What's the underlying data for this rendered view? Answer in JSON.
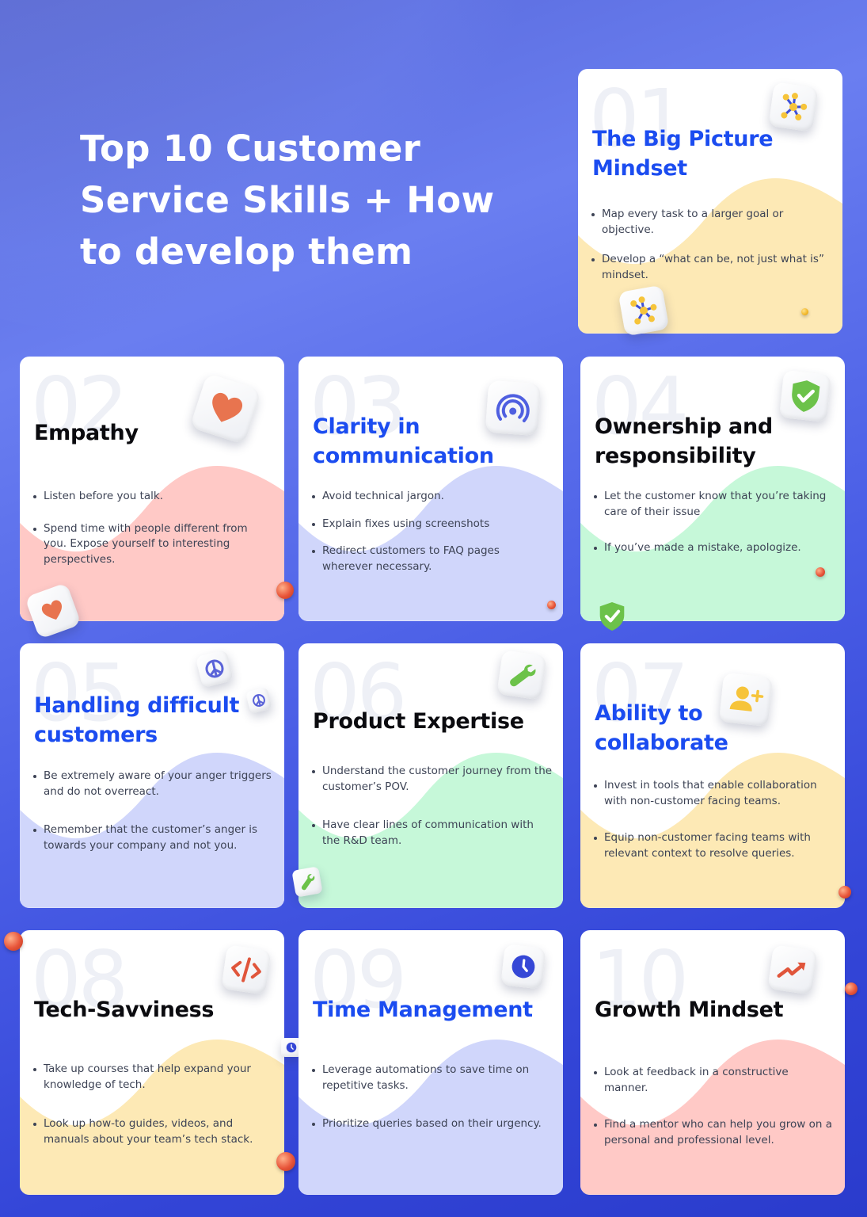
{
  "headline": "Top 10 Customer Service Skills + How to develop them",
  "colors": {
    "background": "#4a5ee6",
    "title_blue": "#1b4cf0",
    "title_black": "#0b0b0f",
    "wave_yellow": "#fde9b5",
    "wave_pink": "#ffc9c6",
    "wave_lavender": "#d0d6fb",
    "wave_green": "#c6f8d9"
  },
  "cards": [
    {
      "number": "01",
      "title": "The Big Picture Mindset",
      "title_color": "blue",
      "icon": "network-nodes-icon",
      "wave": "yellow",
      "bullets": [
        "Map every task to a larger goal or objective.",
        "Develop a “what can be, not just what is” mindset."
      ]
    },
    {
      "number": "02",
      "title": "Empathy",
      "title_color": "black",
      "icon": "heart-icon",
      "wave": "pink",
      "bullets": [
        "Listen before you talk.",
        "Spend time with people different from you. Expose yourself to interesting perspectives."
      ]
    },
    {
      "number": "03",
      "title": "Clarity in communication",
      "title_color": "blue",
      "icon": "broadcast-signal-icon",
      "wave": "lavender",
      "bullets": [
        "Avoid technical jargon.",
        "Explain fixes using screenshots",
        "Redirect customers to FAQ pages wherever necessary."
      ]
    },
    {
      "number": "04",
      "title": "Ownership and responsibility",
      "title_color": "black",
      "icon": "shield-check-icon",
      "wave": "green",
      "bullets": [
        "Let the customer know that you’re taking care of their issue",
        "If you’ve made a mistake, apologize."
      ]
    },
    {
      "number": "05",
      "title": "Handling difficult customers",
      "title_color": "blue",
      "icon": "peace-sign-icon",
      "wave": "lavender",
      "bullets": [
        "Be extremely aware of your anger triggers and do not overreact.",
        "Remember that the customer’s anger is towards your company and not you."
      ]
    },
    {
      "number": "06",
      "title": "Product Expertise",
      "title_color": "black",
      "icon": "wrench-icon",
      "wave": "green",
      "bullets": [
        "Understand the customer journey from the customer’s POV.",
        "Have clear lines of communication with the R&D team."
      ]
    },
    {
      "number": "07",
      "title": "Ability to collaborate",
      "title_color": "blue",
      "icon": "add-user-icon",
      "wave": "yellow",
      "bullets": [
        "Invest in tools that enable collaboration with non-customer facing teams.",
        "Equip non-customer facing teams with relevant context to resolve queries."
      ]
    },
    {
      "number": "08",
      "title": "Tech-Savviness",
      "title_color": "black",
      "icon": "code-icon",
      "wave": "yellow",
      "bullets": [
        "Take up courses that help expand your knowledge of tech.",
        "Look up how-to guides, videos, and manuals about your team’s tech stack."
      ]
    },
    {
      "number": "09",
      "title": "Time Management",
      "title_color": "blue",
      "icon": "clock-icon",
      "wave": "lavender",
      "bullets": [
        "Leverage automations to save time on repetitive tasks.",
        "Prioritize queries based on their urgency."
      ]
    },
    {
      "number": "10",
      "title": "Growth Mindset",
      "title_color": "black",
      "icon": "trending-up-icon",
      "wave": "pink",
      "bullets": [
        "Look at feedback in a constructive manner.",
        "Find a mentor who can help you grow on a personal and professional level."
      ]
    }
  ]
}
